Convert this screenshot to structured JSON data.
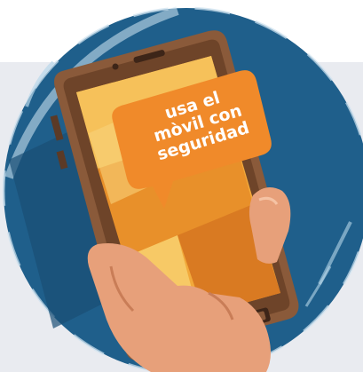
{
  "message": {
    "line1": "usa el",
    "line2": "mòvil con",
    "line3": "seguridad"
  },
  "colors": {
    "circle": "#1f5f8b",
    "panel": "#e9ebf0",
    "phone_body": "#8a5a3a",
    "phone_dark": "#5b3a26",
    "screen": "#f2a93b",
    "bubble": "#f08a2a",
    "skin": "#e7a07a",
    "text": "#ffffff"
  },
  "icons": [
    "smartphone-illustration",
    "hand-illustration",
    "speech-bubble-icon"
  ]
}
